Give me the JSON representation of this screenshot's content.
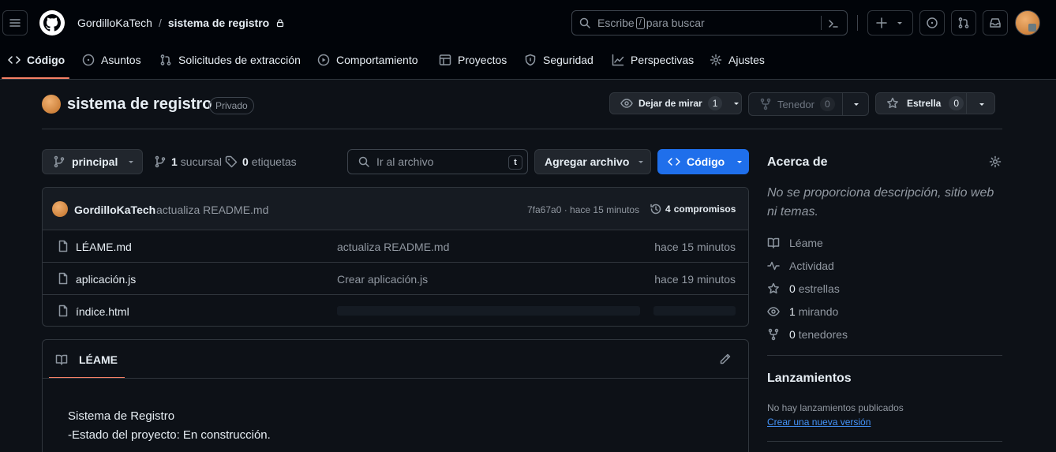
{
  "header": {
    "owner": "GordilloKaTech",
    "separator": "/",
    "repo": "sistema de registro",
    "search_prefix": "Escribe",
    "search_key": "/",
    "search_suffix": "para buscar"
  },
  "nav": {
    "tabs": [
      {
        "label": "Código"
      },
      {
        "label": "Asuntos"
      },
      {
        "label": "Solicitudes de extracción"
      },
      {
        "label": "Comportamiento"
      },
      {
        "label": "Proyectos"
      },
      {
        "label": "Seguridad"
      },
      {
        "label": "Perspectivas"
      },
      {
        "label": "Ajustes"
      }
    ]
  },
  "repo": {
    "name": "sistema de registro",
    "visibility": "Privado",
    "watch_label": "Dejar de mirar",
    "watch_count": "1",
    "fork_label": "Tenedor",
    "fork_count": "0",
    "star_label": "Estrella",
    "star_count": "0"
  },
  "toolbar": {
    "branch": "principal",
    "branches_count": "1",
    "branches_label": "sucursal",
    "tags_count": "0",
    "tags_label": "etiquetas",
    "file_search_placeholder": "Ir al archivo",
    "file_search_key": "t",
    "add_file": "Agregar archivo",
    "code_button": "Código"
  },
  "commit": {
    "author": "GordilloKaTech",
    "message": "actualiza README.md",
    "hash_time": "7fa67a0 · hace 15 minutos",
    "commits_count": "4",
    "commits_label": "compromisos"
  },
  "files": [
    {
      "name": "LÉAME.md",
      "message": "actualiza README.md",
      "time": "hace 15 minutos"
    },
    {
      "name": "aplicación.js",
      "message": "Crear aplicación.js",
      "time": "hace 19 minutos"
    },
    {
      "name": "índice.html",
      "message": "",
      "time": ""
    }
  ],
  "readme": {
    "tab": "LÉAME",
    "line1": "Sistema de Registro",
    "line2": "-Estado del proyecto: En construcción."
  },
  "about": {
    "title": "Acerca de",
    "description": "No se proporciona descripción, sitio web ni temas.",
    "readme": "Léame",
    "activity": "Actividad",
    "stars_count": "0",
    "stars_label": "estrellas",
    "watching_count": "1",
    "watching_label": "mirando",
    "forks_count": "0",
    "forks_label": "tenedores"
  },
  "releases": {
    "title": "Lanzamientos",
    "none": "No hay lanzamientos publicados",
    "create": "Crear una nueva versión"
  },
  "colors": {
    "background": "#0d1117",
    "header": "#010409",
    "accent_tab": "#f78166",
    "primary_button": "#1f6feb",
    "link": "#4493f8"
  }
}
